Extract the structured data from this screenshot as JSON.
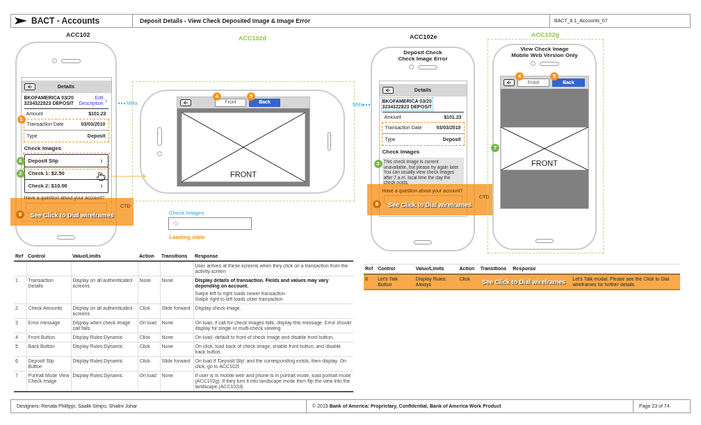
{
  "header": {
    "title": "BACT - Accounts",
    "page_title": "Deposit Details - View Check Deposited Image & Image Error",
    "doc_id": "BACT_6.1_Accounts_07"
  },
  "acc102": {
    "label": "ACC102",
    "bar_title": "Details",
    "merchant": [
      "BKOFAMERICA 03/20",
      "3234322823 DEPOSIT"
    ],
    "edit_link": "Edit Description",
    "fields_badge": {
      "number": "1",
      "color": "#f7941d"
    },
    "fields": [
      {
        "label": "Amount",
        "value": "$101.23"
      },
      {
        "label": "Transaction Date",
        "value": "03/03/2010"
      },
      {
        "label": "Type",
        "value": "Deposit"
      }
    ],
    "section": "Check Images",
    "check_rows": [
      {
        "label": "Deposit Slip",
        "badge": {
          "number": "6",
          "color": "#7ab648"
        }
      },
      {
        "label": "Check 1: $2.50",
        "badge": {
          "number": "2",
          "color": "#7ab648"
        }
      },
      {
        "label": "Check 2: $10.00"
      }
    ],
    "question": "Have a question about your account?",
    "mm_label": "MMa",
    "ctd_label": "CTD",
    "overlay": {
      "badge": "8",
      "text": "See Click to Dial wireframes"
    }
  },
  "acc102d": {
    "label": "ACC102d",
    "front": {
      "label": "Front",
      "selected": false,
      "badge": {
        "number": "4",
        "color": "#f7941d"
      }
    },
    "back": {
      "label": "Back",
      "selected": true,
      "badge": {
        "number": "5",
        "color": "#f7941d"
      }
    },
    "image_caption": "FRONT",
    "mm_label": "MMa",
    "loading": {
      "title": "Check Images",
      "caption": "Loading state"
    }
  },
  "acc102e": {
    "label": "ACC102e",
    "title": [
      "Deposit Check",
      "Check Image Error"
    ],
    "bar_title": "Details",
    "merchant": [
      "BKOFAMERICA 03/20",
      "3234322823 DEPOSIT"
    ],
    "fields": [
      {
        "label": "Amount",
        "value": "$101.23"
      },
      {
        "label": "Transaction Date",
        "value": "03/03/2010"
      },
      {
        "label": "Type",
        "value": "Deposit"
      }
    ],
    "section": "Check Images",
    "message": "This check image is current unavailable, but please try again later. You can usually view check images after 7 a.m. local time the day the check posts.",
    "message_badge": {
      "number": "3",
      "color": "#7ab648"
    },
    "question": "Have a question about your account?",
    "ctd_label": "CTD",
    "overlay": {
      "badge": "8",
      "text": "See Click to Dial wireframes"
    }
  },
  "acc102g": {
    "label": "ACC102g",
    "title": [
      "View Check Image",
      "Mobile Web Version Only"
    ],
    "front": {
      "label": "Front",
      "selected": false,
      "badge": {
        "number": "4",
        "color": "#f7941d"
      }
    },
    "back": {
      "label": "Back",
      "selected": true,
      "badge": {
        "number": "5",
        "color": "#f7941d"
      }
    },
    "image_caption": "FRONT",
    "image_badge": {
      "number": "7",
      "color": "#7ab648"
    }
  },
  "table": {
    "columns": [
      "Ref",
      "Control",
      "Value/Limits",
      "Action",
      "Transitions",
      "Response"
    ],
    "rows": [
      {
        "ref": "",
        "control": "",
        "value": "",
        "action": "",
        "transitions": "",
        "response": [
          {
            "text": "User arrives at these screens when they click on a transaction from the activity screen",
            "bold": false
          }
        ]
      },
      {
        "ref": "1",
        "control": "Transaction Details",
        "value": "Display on all authenticated screens",
        "action": "None",
        "transitions": "None",
        "response": [
          {
            "text": "Display details of transaction. Fields and values may vary depending on account.",
            "bold": true
          },
          {
            "text": "Swipe left to right loads newer transaction",
            "bold": false
          },
          {
            "text": "Swipe right to left loads older transaction",
            "bold": false
          }
        ]
      },
      {
        "ref": "2",
        "control": "Check Amounts",
        "value": "Display on all authenticated screens",
        "action": "Click",
        "transitions": "Slide forward",
        "response": [
          {
            "text": "Display check image.",
            "bold": false
          }
        ]
      },
      {
        "ref": "3",
        "control": "Error message",
        "value": "Display when check image call fails",
        "action": "On load",
        "transitions": "None",
        "response": [
          {
            "text": "On load, if call for check images fails, display this message. Error should display for single or multi-check viewing",
            "bold": false
          }
        ]
      },
      {
        "ref": "4",
        "control": "Front Button",
        "value": "Display Rules:Dynamic",
        "action": "Click",
        "transitions": "None",
        "response": [
          {
            "text": "On load, default to front of check image and disable front button.",
            "bold": false
          }
        ]
      },
      {
        "ref": "5",
        "control": "Back Button",
        "value": "Display Rules:Dynamic",
        "action": "Click",
        "transitions": "None",
        "response": [
          {
            "text": "On click, load back of check image, enable front button, and disable back button.",
            "bold": false
          }
        ]
      },
      {
        "ref": "6",
        "control": "Deposit Slip Button",
        "value": "Display Rules:Dynamic",
        "action": "Click",
        "transitions": "Slide forward",
        "response": [
          {
            "text": "On load if 'Deposit Slip' and the corresponding exists, then display. On click, go to ACC102f.",
            "bold": false
          }
        ]
      },
      {
        "ref": "7",
        "control": "Portrait Mode View Check Image",
        "value": "Display Rules:Dynamic",
        "action": "On load",
        "transitions": "None",
        "response": [
          {
            "text": "If user is in mobile web and phone is in portrait mode, load portrait mode (ACC102g). If they turn it into landscape mode then flip the view into the landscape (ACC102d)",
            "bold": false
          }
        ]
      }
    ]
  },
  "table_2": {
    "columns": [
      "Ref",
      "Control",
      "Value/Limits",
      "Action",
      "Transitions",
      "Response"
    ],
    "rows": [
      {
        "ref": "8",
        "control": "Let's Talk Button",
        "value": "Display Rules: Always",
        "action": "Click",
        "response": "Let's Talk modal. Please see the Click to Dial wireframes for further details."
      }
    ],
    "overlay": {
      "text": "See Click to Dial wireframes"
    }
  },
  "footer": {
    "designers": "Designers: Renata Phillippi, Saalik Simpo, Shalini Johar",
    "copyright": "© 2015 **Bank of America: Proprietary, Confidential, Bank of America Work Product**",
    "page": "Page 23 of 74"
  }
}
